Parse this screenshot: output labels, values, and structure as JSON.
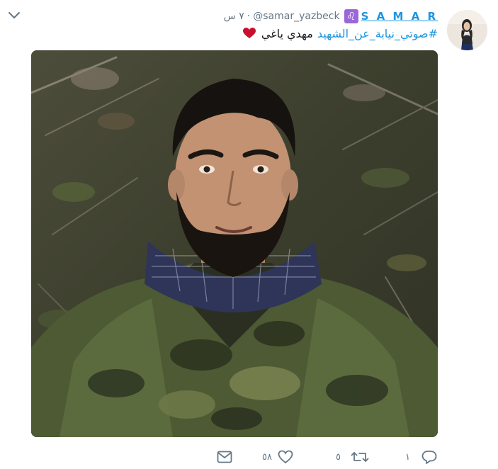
{
  "tweet": {
    "display_name": "S A M A R",
    "name_badge_glyph": "♌",
    "handle": "@samar_yazbeck",
    "time_separator": "·",
    "time": "٧ س",
    "hashtag": "#صوتي_نيابة_عن_الشهيد",
    "text": "مهدي ياغي",
    "emoji": "red-heart-emoji"
  },
  "actions": {
    "reply_count": "١",
    "retweet_count": "٥",
    "like_count": "٥٨"
  },
  "icons": {
    "caret": "chevron-down-icon",
    "reply": "reply-icon",
    "retweet": "retweet-icon",
    "like": "heart-icon",
    "message": "envelope-icon"
  },
  "colors": {
    "link": "#1b95e0",
    "muted": "#657786",
    "heart_emoji": "#c8102e"
  }
}
